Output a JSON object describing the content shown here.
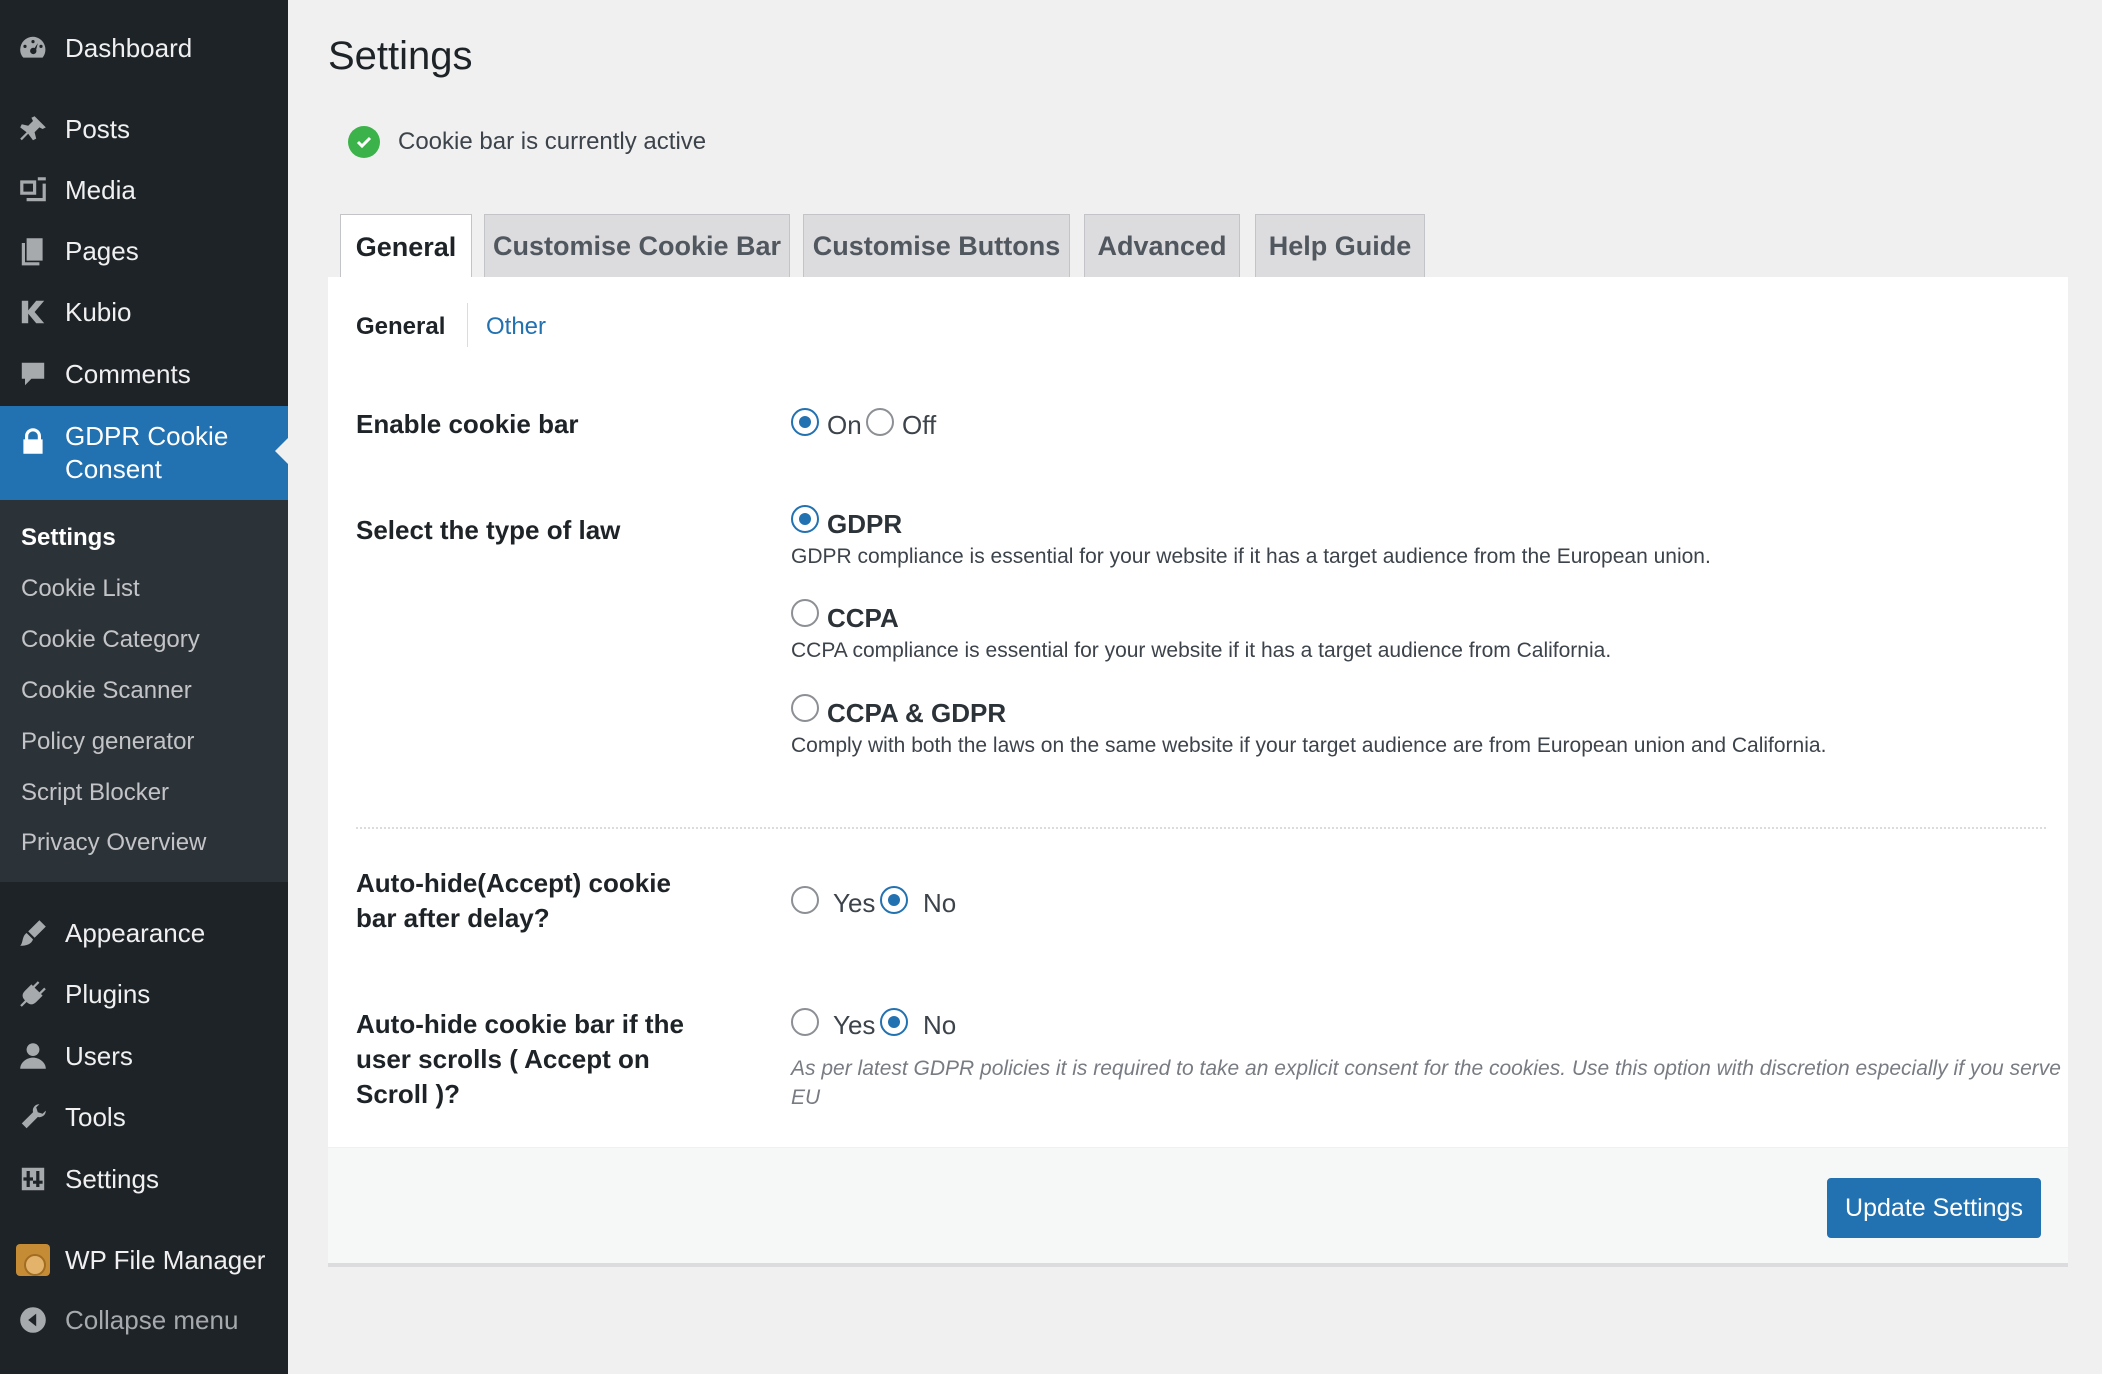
{
  "sidebar": {
    "items": [
      {
        "label": "Dashboard",
        "icon": "dashboard-icon"
      },
      {
        "label": "Posts",
        "icon": "pin-icon"
      },
      {
        "label": "Media",
        "icon": "media-icon"
      },
      {
        "label": "Pages",
        "icon": "pages-icon"
      },
      {
        "label": "Kubio",
        "icon": "kubio-icon"
      },
      {
        "label": "Comments",
        "icon": "comment-icon"
      },
      {
        "label": "GDPR Cookie Consent",
        "label_line1": "GDPR Cookie",
        "label_line2": "Consent",
        "icon": "lock-icon"
      },
      {
        "label": "Appearance",
        "icon": "brush-icon"
      },
      {
        "label": "Plugins",
        "icon": "plug-icon"
      },
      {
        "label": "Users",
        "icon": "user-icon"
      },
      {
        "label": "Tools",
        "icon": "wrench-icon"
      },
      {
        "label": "Settings",
        "icon": "sliders-icon"
      },
      {
        "label": "WP File Manager",
        "icon": "folder-icon"
      },
      {
        "label": "Collapse menu",
        "icon": "collapse-icon"
      }
    ],
    "submenu": [
      "Settings",
      "Cookie List",
      "Cookie Category",
      "Cookie Scanner",
      "Policy generator",
      "Script Blocker",
      "Privacy Overview"
    ]
  },
  "page": {
    "title": "Settings",
    "status": "Cookie bar is currently active"
  },
  "tabs": [
    "General",
    "Customise Cookie Bar",
    "Customise Buttons",
    "Advanced",
    "Help Guide"
  ],
  "subtabs": {
    "active": "General",
    "other": "Other"
  },
  "form": {
    "enable_cookie_bar": {
      "label": "Enable cookie bar",
      "on": "On",
      "off": "Off",
      "selected": "On"
    },
    "law": {
      "label": "Select the type of law",
      "selected": "GDPR",
      "options": [
        {
          "name": "GDPR",
          "desc": "GDPR compliance is essential for your website if it has a target audience from the European union."
        },
        {
          "name": "CCPA",
          "desc": "CCPA compliance is essential for your website if it has a target audience from California."
        },
        {
          "name": "CCPA & GDPR",
          "desc": "Comply with both the laws on the same website if your target audience are from European union and California."
        }
      ]
    },
    "auto_hide_delay": {
      "label_line1": "Auto-hide(Accept) cookie",
      "label_line2": "bar after delay?",
      "yes": "Yes",
      "no": "No",
      "selected": "No"
    },
    "auto_hide_scroll": {
      "label_line1": "Auto-hide cookie bar if the",
      "label_line2": "user scrolls ( Accept on",
      "label_line3": "Scroll )?",
      "yes": "Yes",
      "no": "No",
      "selected": "No",
      "note": "As per latest GDPR policies it is required to take an explicit consent for the cookies. Use this option with discretion especially if you serve EU"
    }
  },
  "footer": {
    "update_label": "Update Settings"
  },
  "colors": {
    "accent": "#2271b1",
    "sidebar": "#1d2327",
    "success": "#3cb34a"
  }
}
